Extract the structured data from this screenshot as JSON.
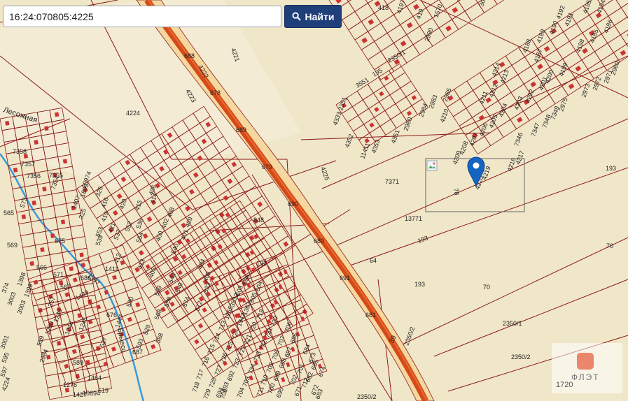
{
  "search": {
    "value": "16:24:070805:4225",
    "button_label": "Найти",
    "button_icon": "search-icon"
  },
  "marker": {
    "label": "4225",
    "color": "#1565c0"
  },
  "colors": {
    "background": "#f0e6c8",
    "parcel_line": "#8b1a1a",
    "highway": "#d64a1a",
    "building": "#cc3333",
    "water": "#3a9ad9"
  },
  "roads": {
    "river": "Брыесо",
    "street_left": "Лесожная",
    "highway_number": "39"
  },
  "parcel_labels": [
    {
      "t": "418"
    },
    {
      "t": "4197"
    },
    {
      "t": "419"
    },
    {
      "t": "2990"
    },
    {
      "t": "3008"
    },
    {
      "t": "1570"
    },
    {
      "t": "4195"
    },
    {
      "t": "4194"
    },
    {
      "t": "4192"
    },
    {
      "t": "4191"
    },
    {
      "t": "4190"
    },
    {
      "t": "4189"
    },
    {
      "t": "4188"
    },
    {
      "t": "4187"
    },
    {
      "t": "4186"
    },
    {
      "t": "4185"
    },
    {
      "t": "4198"
    },
    {
      "t": "4199"
    },
    {
      "t": "4200"
    },
    {
      "t": "4201"
    },
    {
      "t": "4202"
    },
    {
      "t": "4203"
    },
    {
      "t": "4204"
    },
    {
      "t": "4205"
    },
    {
      "t": "4206"
    },
    {
      "t": "4207"
    },
    {
      "t": "4208"
    },
    {
      "t": "4209"
    },
    {
      "t": "4210"
    },
    {
      "t": "4211"
    },
    {
      "t": "4212"
    },
    {
      "t": "4213"
    },
    {
      "t": "4214"
    },
    {
      "t": "4217"
    },
    {
      "t": "4218"
    },
    {
      "t": "4219"
    },
    {
      "t": "4220"
    },
    {
      "t": "4221"
    },
    {
      "t": "4222"
    },
    {
      "t": "4223"
    },
    {
      "t": "4224"
    },
    {
      "t": "4225"
    },
    {
      "t": "7371"
    },
    {
      "t": "78"
    },
    {
      "t": "13771"
    },
    {
      "t": "64"
    },
    {
      "t": "848"
    },
    {
      "t": "192"
    },
    {
      "t": "193"
    },
    {
      "t": "193"
    },
    {
      "t": "193"
    },
    {
      "t": "70"
    },
    {
      "t": "70"
    },
    {
      "t": "2350/1"
    },
    {
      "t": "2350/2"
    },
    {
      "t": "2350/2"
    },
    {
      "t": "2350/2"
    },
    {
      "t": "3551"
    },
    {
      "t": "195"
    },
    {
      "t": "2350/1"
    },
    {
      "t": "4333 2351"
    },
    {
      "t": "11411"
    },
    {
      "t": "4353"
    },
    {
      "t": "4352"
    },
    {
      "t": "4351"
    },
    {
      "t": "2980"
    },
    {
      "t": "2984"
    },
    {
      "t": "2983"
    },
    {
      "t": "2985"
    },
    {
      "t": "2960"
    },
    {
      "t": "2971"
    },
    {
      "t": "2972"
    },
    {
      "t": "2973"
    },
    {
      "t": "2975"
    },
    {
      "t": "7349"
    },
    {
      "t": "7348"
    },
    {
      "t": "7347"
    },
    {
      "t": "7346"
    },
    {
      "t": "7358"
    },
    {
      "t": "7357"
    },
    {
      "t": "7356"
    },
    {
      "t": "7355"
    },
    {
      "t": "7354"
    },
    {
      "t": "10974"
    },
    {
      "t": "1803"
    },
    {
      "t": "1407"
    },
    {
      "t": "325"
    },
    {
      "t": "326"
    },
    {
      "t": "416"
    },
    {
      "t": "419"
    },
    {
      "t": "421"
    },
    {
      "t": "420"
    },
    {
      "t": "415"
    },
    {
      "t": "414"
    },
    {
      "t": "406"
    },
    {
      "t": "408"
    },
    {
      "t": "409"
    },
    {
      "t": "402"
    },
    {
      "t": "401"
    },
    {
      "t": "400"
    },
    {
      "t": "540"
    },
    {
      "t": "554"
    },
    {
      "t": "539"
    },
    {
      "t": "553"
    },
    {
      "t": "537"
    },
    {
      "t": "552"
    },
    {
      "t": "536"
    },
    {
      "t": "412"
    },
    {
      "t": "413"
    },
    {
      "t": "405"
    },
    {
      "t": "404"
    },
    {
      "t": "403"
    },
    {
      "t": "533"
    },
    {
      "t": "548"
    },
    {
      "t": "549"
    },
    {
      "t": "559"
    },
    {
      "t": "558"
    },
    {
      "t": "568"
    },
    {
      "t": "572"
    },
    {
      "t": "574"
    },
    {
      "t": "565"
    },
    {
      "t": "569"
    },
    {
      "t": "566"
    },
    {
      "t": "571"
    },
    {
      "t": "567"
    },
    {
      "t": "573"
    },
    {
      "t": "1397"
    },
    {
      "t": "1411"
    },
    {
      "t": "1398"
    },
    {
      "t": "1399"
    },
    {
      "t": "374"
    },
    {
      "t": "3003"
    },
    {
      "t": "3003"
    },
    {
      "t": "1439"
    },
    {
      "t": "357"
    },
    {
      "t": "1249"
    },
    {
      "t": "1250"
    },
    {
      "t": "1245"
    },
    {
      "t": "1246"
    },
    {
      "t": "2984"
    },
    {
      "t": "527"
    },
    {
      "t": "529"
    },
    {
      "t": "528"
    },
    {
      "t": "588"
    },
    {
      "t": "589"
    },
    {
      "t": "590"
    },
    {
      "t": "593"
    },
    {
      "t": "1447"
    },
    {
      "t": "1276"
    },
    {
      "t": "1427"
    },
    {
      "t": "1464"
    },
    {
      "t": "10894"
    },
    {
      "t": "619"
    },
    {
      "t": "4224"
    },
    {
      "t": "3001"
    },
    {
      "t": "595"
    },
    {
      "t": "597"
    },
    {
      "t": "596"
    },
    {
      "t": "604"
    },
    {
      "t": "603"
    },
    {
      "t": "605"
    },
    {
      "t": "3532"
    },
    {
      "t": "1362"
    },
    {
      "t": "1255"
    },
    {
      "t": "1342"
    },
    {
      "t": "713"
    },
    {
      "t": "724"
    },
    {
      "t": "714"
    },
    {
      "t": "725"
    },
    {
      "t": "715"
    },
    {
      "t": "726"
    },
    {
      "t": "716"
    },
    {
      "t": "727"
    },
    {
      "t": "717"
    },
    {
      "t": "728"
    },
    {
      "t": "718"
    },
    {
      "t": "729"
    },
    {
      "t": "719"
    },
    {
      "t": "730"
    },
    {
      "t": "720"
    },
    {
      "t": "731"
    },
    {
      "t": "721"
    },
    {
      "t": "732"
    },
    {
      "t": "722"
    },
    {
      "t": "733"
    },
    {
      "t": "723"
    },
    {
      "t": "734"
    },
    {
      "t": "692"
    },
    {
      "t": "703"
    },
    {
      "t": "693"
    },
    {
      "t": "704"
    },
    {
      "t": "694"
    },
    {
      "t": "705"
    },
    {
      "t": "695"
    },
    {
      "t": "706"
    },
    {
      "t": "696"
    },
    {
      "t": "707"
    },
    {
      "t": "697"
    },
    {
      "t": "708"
    },
    {
      "t": "698"
    },
    {
      "t": "709"
    },
    {
      "t": "699"
    },
    {
      "t": "710"
    },
    {
      "t": "700"
    },
    {
      "t": "711"
    },
    {
      "t": "701"
    },
    {
      "t": "702"
    },
    {
      "t": "712"
    },
    {
      "t": "671"
    },
    {
      "t": "682"
    },
    {
      "t": "672"
    },
    {
      "t": "683"
    },
    {
      "t": "673"
    },
    {
      "t": "684"
    },
    {
      "t": "674"
    },
    {
      "t": "685"
    },
    {
      "t": "675"
    },
    {
      "t": "686"
    },
    {
      "t": "676"
    },
    {
      "t": "687"
    },
    {
      "t": "677"
    },
    {
      "t": "688"
    },
    {
      "t": "678"
    },
    {
      "t": "689"
    },
    {
      "t": "679"
    },
    {
      "t": "690"
    },
    {
      "t": "680"
    },
    {
      "t": "691"
    },
    {
      "t": "681"
    }
  ],
  "watermark": {
    "logo_text": "ФЛЭТ",
    "number": "1720"
  }
}
